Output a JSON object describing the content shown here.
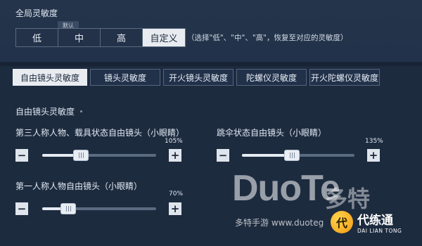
{
  "global": {
    "title": "全局灵敏度",
    "presets": [
      "低",
      "中",
      "高",
      "自定义"
    ],
    "selected_preset": "自定义",
    "default_badge": "默认",
    "hint": "（选择\"低\"、\"中\"、\"高\"，恢复至对应的灵敏度）"
  },
  "tabs": [
    "自由镜头灵敏度",
    "镜头灵敏度",
    "开火镜头灵敏度",
    "陀螺仪灵敏度",
    "开火陀螺仪灵敏度"
  ],
  "active_tab": "自由镜头灵敏度",
  "section": {
    "title": "自由镜头灵敏度"
  },
  "settings": {
    "third_person": {
      "label": "第三人称人物、载具状态自由镜头（小眼睛）",
      "value": "105%",
      "level": 105
    },
    "parachute": {
      "label": "跳伞状态自由镜头（小眼睛）",
      "value": "135%",
      "level": 135
    },
    "first_person": {
      "label": "第一人称人物自由镜头（小眼睛）",
      "value": "70%",
      "level": 70
    }
  },
  "buttons": {
    "minus": "−",
    "plus": "+"
  },
  "watermark": {
    "logo_text": "DuoTe",
    "logo_cn": "多特",
    "sub": "多特手游 www.duoteg"
  },
  "brand": {
    "name": "代练通",
    "en": "DAI LIAN TONG",
    "logo_glyph": "代"
  },
  "colors": {
    "background": "#1d2b3f",
    "selected": "#e8ecf1",
    "brand_accent": "#f39a12"
  }
}
